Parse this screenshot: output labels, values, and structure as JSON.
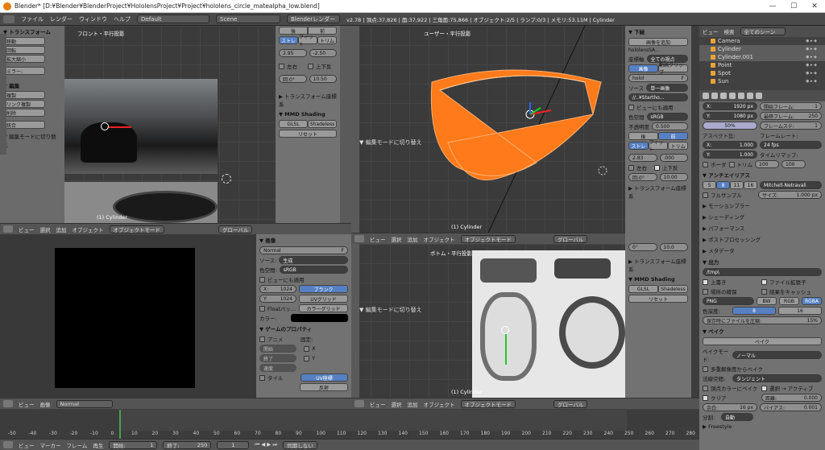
{
  "window": {
    "title": "Blender* [D:¥Blender¥BlenderProject¥HololensProject¥Project¥hololens_circle_matealpha_low.blend]",
    "min": "—",
    "max": "☐",
    "close": "✕"
  },
  "menu": {
    "file": "ファイル",
    "render": "レンダー",
    "window": "ウィンドウ",
    "help": "ヘルプ",
    "layout": "Default",
    "scene": "Scene",
    "engine": "Blenderレンダー",
    "stats": "v2.78 | 頂点:37,826 | 面:37,922 | 三角面:75,866 | オブジェクト:2/5 | ランプ:0/3 | メモリ:53.11M | Cylinder"
  },
  "left_tools": {
    "transform": "▼ トランスフォーム",
    "move": "移動",
    "rotate": "回転",
    "scale": "拡大縮小",
    "mirror": "ミラー:",
    "edit": "▼ 編集",
    "dup": "複製",
    "link_dup": "リンク複製",
    "del": "削除",
    "join": "統合",
    "editmode": "▼ 編集モードに切り替え",
    "tabs": [
      "ツール",
      "作成",
      "関係",
      "アニメ",
      "物理",
      "グリース"
    ]
  },
  "vp_tl": {
    "label": "フロント・平行投影",
    "obj": "(1) Cylinder"
  },
  "vp_tr": {
    "label": "ユーザー・平行投影",
    "obj": "(1) Cylinder"
  },
  "vp_br": {
    "label": "ボトム・平行投影",
    "obj": "(1) Cylinder"
  },
  "npanel_a": {
    "back": "後",
    "front": "前",
    "stretch": "ストレ",
    "fit": "フィット",
    "crop": "トリム",
    "v1": "2.95",
    "v2": "-2.50",
    "left": "左右",
    "updown": "上下反",
    "rot": "回:0°",
    "v3": "10.50",
    "transform": "▶ トランスフォーム座標系",
    "mmd": "▼ MMD Shading",
    "glsl": "GLSL",
    "shadeless": "Shadeless",
    "reset": "リセット"
  },
  "npanel_b": {
    "bg": "▼ 下絵",
    "addimg": "画像を追加",
    "name": "hololensSA...",
    "axis": "座標軸",
    "allviews": "全ての視点",
    "image": "画像",
    "movie": "動画クリップ",
    "holo": "holol",
    "F": "F",
    "source": "ソース",
    "single": "単一画像",
    "path": "//..¥Startho...",
    "apply_view": "ビューにも適用",
    "colorspace": "色空間",
    "srgb": "sRGB",
    "opacity": "不透明度",
    "opacity_v": "0.500",
    "back": "後",
    "front": "前",
    "stretch": "ストレ",
    "fit": "フィット",
    "crop": "トリム",
    "v1": "2.83",
    "v2": ".000",
    "left": "左右",
    "updown": "上下反",
    "rot": "回:0°",
    "v3": "10.00",
    "transform": "▶ トランスフォーム座標系"
  },
  "npanel_c": {
    "v1": "0°",
    "v2": "10.0",
    "transform": "▶ トランスフォーム座標系",
    "mmd": "▼ MMD Shading",
    "glsl": "GLSL",
    "shadeless": "Shadeless",
    "reset": "リセット"
  },
  "image_panel": {
    "title": "▼ 画像",
    "name": "Normal",
    "F": "F",
    "source": "ソース:",
    "gen": "生成",
    "cs": "色空間:",
    "srgb": "sRGB",
    "apply_view": "ビューにも適用",
    "x": "X:",
    "xv": "1024",
    "y": "Y:",
    "yv": "1024",
    "blank": "ブランク",
    "uvgrid": "UVグリッド",
    "float": "Floatバッ...",
    "colorgrid": "カラーグリッド",
    "color": "カラー:",
    "game": "▼ ゲームのプロパティ",
    "anime": "アニメ",
    "fixed": "固定:",
    "start": "開始",
    "end": "終了",
    "speed": "速度",
    "x2": "X",
    "y2": "Y",
    "tile": "タイル",
    "uv": "UV座標",
    "reflect": "反射",
    "normal": "Normal"
  },
  "hdr": {
    "view": "ビュー",
    "select": "選択",
    "add": "追加",
    "object": "オブジェクト",
    "mode": "オブジェクトモード",
    "global": "グローバル",
    "image": "画像"
  },
  "outliner": {
    "view": "ビュー",
    "search": "検索",
    "scenes": "全てのシーン",
    "items": [
      "Camera",
      "Cylinder",
      "Cylinder.001",
      "Point",
      "Spot",
      "Sun"
    ]
  },
  "props": {
    "x": "X:",
    "xv": "1920 px",
    "y": "Y:",
    "yv": "1080 px",
    "pct": "50%",
    "start": "開始フレーム:",
    "startv": "1",
    "end": "最終フレーム:",
    "endv": "250",
    "step": "フレームステ:",
    "stepv": "1",
    "aspect": "アスペクト比:",
    "ax": "1.000",
    "ay": "1.000",
    "fps": "フレームレート:",
    "fpsv": "24 fps",
    "remap": "タイムリマップ:",
    "r1": "100",
    "r2": "100",
    "border": "ボーダ",
    "crop": "トリム",
    "aa": "▼ アンチエイリアス",
    "aa_vals": [
      "5",
      "8",
      "11",
      "16"
    ],
    "filter": "Mitchell-Netravali",
    "full": "フルサンプル",
    "size": "サイズ:",
    "sizev": "1.000 px",
    "motion": "▶ モーションブラー",
    "shading": "▶ シェーディング",
    "perf": "▶ パフォーマンス",
    "post": "▶ ポストプロセッシング",
    "meta": "▶ メタデータ",
    "output": "▼ 出力",
    "path": "/tmp\\",
    "overwrite": "上書き",
    "ext": "ファイル拡張子",
    "placeholder": "場所の確保",
    "cache": "結果をキャッシュ",
    "png": "PNG",
    "bw": "BW",
    "rgb": "RGB",
    "rgba": "RGBA",
    "depth": "色深度:",
    "d8": "8",
    "d16": "16",
    "compress": "保存時にファイルを圧縮:",
    "compv": "15%",
    "bake": "▼ ベイク",
    "bakebtn": "ベイク",
    "baketype": "ベイクモード:",
    "normal": "ノーマル",
    "multires": "多重解像度からベイク",
    "normspace": "法線空間:",
    "tangent": "タンジェント",
    "vcolor": "頂点カラーにベイク",
    "selact": "選択 → アクティブ",
    "clear": "クリア",
    "dist": "距離:",
    "distv": "0.000",
    "margin": "余白:",
    "marginv": "16 px",
    "bias": "バイアス:",
    "biasv": "0.001",
    "split": "分割:",
    "auto": "自動",
    "freestyle": "▶ Freestyle"
  },
  "timeline": {
    "ticks": [
      "-50",
      "-40",
      "-30",
      "-20",
      "-10",
      "0",
      "10",
      "20",
      "30",
      "40",
      "50",
      "60",
      "70",
      "80",
      "90",
      "100",
      "110",
      "120",
      "130",
      "140",
      "150",
      "160",
      "170",
      "180",
      "190",
      "200",
      "210",
      "220",
      "230",
      "240",
      "250",
      "260",
      "270",
      "280"
    ],
    "view": "ビュー",
    "marker": "マーカー",
    "frame": "フレーム",
    "play": "再生",
    "start": "開始:",
    "startv": "1",
    "end": "終了:",
    "endv": "250",
    "cur": "1",
    "sync": "同期しない"
  },
  "colors": {
    "orange": "#ff7a1a",
    "blue": "#5680c2"
  }
}
